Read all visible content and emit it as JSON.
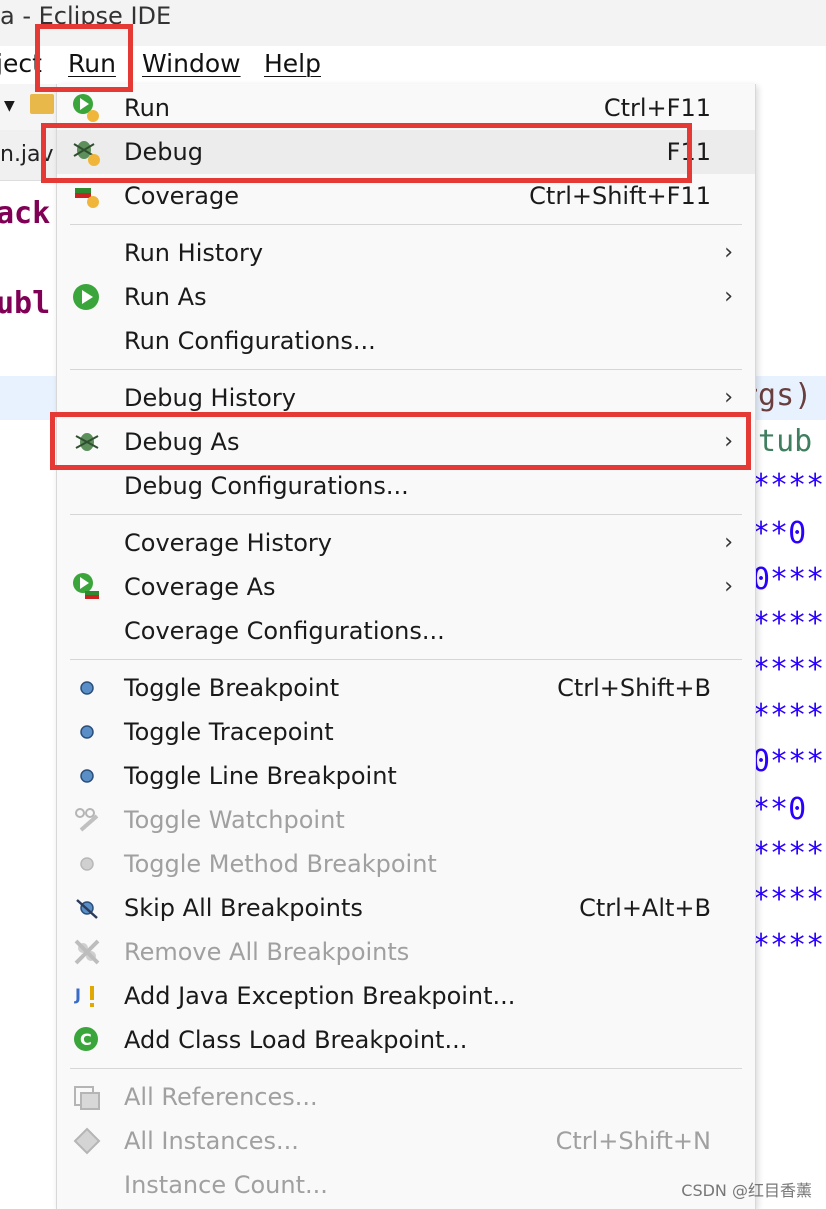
{
  "window": {
    "title": "a - Eclipse IDE"
  },
  "menubar": {
    "project_fragment": "ject",
    "run": "Run",
    "window": "Window",
    "help": "Help"
  },
  "editor": {
    "tab_fragment": "n.jav",
    "code_fragments": [
      "ack",
      "ubl",
      "rgs)",
      "stub",
      "****",
      "**0",
      "0***",
      "****",
      "****",
      "****",
      "0***",
      "**0",
      "****",
      "****",
      "****"
    ]
  },
  "run_menu": {
    "items": [
      {
        "label": "Run",
        "accel": "Ctrl+F11",
        "icon": "run-icon"
      },
      {
        "label": "Debug",
        "accel": "F11",
        "icon": "debug-bug-icon"
      },
      {
        "label": "Coverage",
        "accel": "Ctrl+Shift+F11",
        "icon": "coverage-icon"
      },
      {
        "label": "Run History"
      },
      {
        "label": "Run As",
        "icon": "run-as-icon"
      },
      {
        "label": "Run Configurations..."
      },
      {
        "label": "Debug History"
      },
      {
        "label": "Debug As",
        "icon": "debug-bug-icon"
      },
      {
        "label": "Debug Configurations..."
      },
      {
        "label": "Coverage History"
      },
      {
        "label": "Coverage As",
        "icon": "coverage-as-icon"
      },
      {
        "label": "Coverage Configurations..."
      },
      {
        "label": "Toggle Breakpoint",
        "accel": "Ctrl+Shift+B",
        "icon": "breakpoint-dot-icon"
      },
      {
        "label": "Toggle Tracepoint",
        "icon": "tracepoint-dot-icon"
      },
      {
        "label": "Toggle Line Breakpoint",
        "icon": "line-breakpoint-dot-icon"
      },
      {
        "label": "Toggle Watchpoint",
        "icon": "watchpoint-icon"
      },
      {
        "label": "Toggle Method Breakpoint",
        "icon": "method-breakpoint-icon"
      },
      {
        "label": "Skip All Breakpoints",
        "accel": "Ctrl+Alt+B",
        "icon": "skip-breakpoints-icon"
      },
      {
        "label": "Remove All Breakpoints",
        "icon": "remove-breakpoints-icon"
      },
      {
        "label": "Add Java Exception Breakpoint...",
        "icon": "java-exception-icon"
      },
      {
        "label": "Add Class Load Breakpoint...",
        "icon": "class-load-icon"
      },
      {
        "label": "All References...",
        "icon": "references-icon"
      },
      {
        "label": "All Instances...",
        "accel": "Ctrl+Shift+N",
        "icon": "instances-icon"
      },
      {
        "label": "Instance Count..."
      }
    ]
  },
  "watermark": "CSDN @红目香薰",
  "colors": {
    "highlight_box": "#e53935",
    "menu_bg": "#f9f9f9",
    "disabled_text": "#a0a0a0"
  }
}
